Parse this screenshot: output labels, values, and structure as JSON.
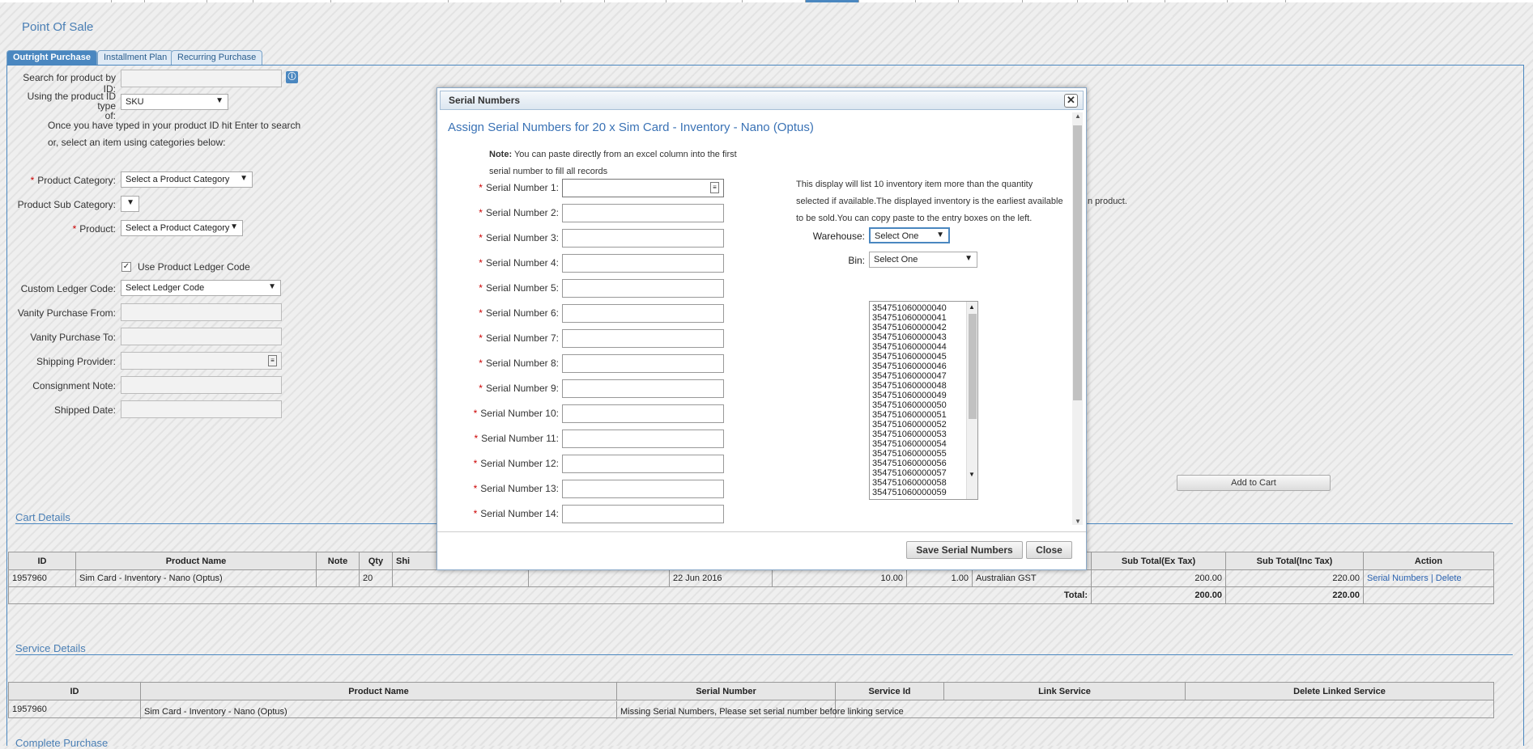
{
  "page": {
    "title": "Point Of Sale"
  },
  "tabs": [
    {
      "label": "Outright Purchase"
    },
    {
      "label": "Installment Plan"
    },
    {
      "label": "Recurring Purchase"
    }
  ],
  "form": {
    "search_label": "Search for product by ID:",
    "id_type_label_1": "Using the product ID type",
    "id_type_label_2": "of:",
    "id_type_value": "SKU",
    "hint_1": "Once you have typed in your product ID hit Enter to search",
    "hint_2": "or, select an item using categories below:",
    "category_label": "Product Category:",
    "category_value": "Select a Product Category",
    "subcategory_label": "Product Sub Category:",
    "product_label": "Product:",
    "product_value": "Select a Product Category",
    "use_ledger_label": "Use Product Ledger Code",
    "custom_ledger_label": "Custom Ledger Code:",
    "custom_ledger_value": "Select Ledger Code",
    "vanity_from_label": "Vanity Purchase From:",
    "vanity_to_label": "Vanity Purchase To:",
    "shipping_provider_label": "Shipping Provider:",
    "consignment_label": "Consignment Note:",
    "shipped_date_label": "Shipped Date:",
    "product_fragment": "n product.",
    "add_to_cart": "Add to Cart"
  },
  "cart": {
    "title": "Cart Details",
    "headers": [
      "ID",
      "Product Name",
      "Note",
      "Qty",
      "Shi",
      "Sub Total(Ex Tax)",
      "Sub Total(Inc Tax)",
      "Action"
    ],
    "row": {
      "id": "1957960",
      "name": "Sim Card - Inventory - Nano (Optus)",
      "note": "",
      "qty": "20",
      "date": "22 Jun 2016",
      "price": "10.00",
      "qty2": "1.00",
      "tax": "Australian GST",
      "sub_ex": "200.00",
      "sub_inc": "220.00",
      "action_serials": "Serial Numbers",
      "action_sep": "|",
      "action_delete": "Delete"
    },
    "total_label": "Total:",
    "total_ex": "200.00",
    "total_inc": "220.00"
  },
  "service": {
    "title": "Service Details",
    "headers": [
      "ID",
      "Product Name",
      "Serial Number",
      "Service Id",
      "Link Service",
      "Delete Linked Service"
    ],
    "row": {
      "id": "1957960",
      "name": "Sim Card - Inventory - Nano (Optus)",
      "message": "Missing Serial Numbers, Please set serial number before linking service"
    }
  },
  "complete": {
    "title": "Complete Purchase"
  },
  "dialog": {
    "title": "Serial Numbers",
    "heading": "Assign Serial Numbers for 20 x Sim Card - Inventory - Nano (Optus)",
    "note_bold": "Note:",
    "note_text_1": "You can paste directly from an excel column into the first",
    "note_text_2": "serial number to fill all records",
    "serial_labels": [
      "Serial Number 1:",
      "Serial Number 2:",
      "Serial Number 3:",
      "Serial Number 4:",
      "Serial Number 5:",
      "Serial Number 6:",
      "Serial Number 7:",
      "Serial Number 8:",
      "Serial Number 9:",
      "Serial Number 10:",
      "Serial Number 11:",
      "Serial Number 12:",
      "Serial Number 13:",
      "Serial Number 14:"
    ],
    "info_1": "This display will list 10 inventory item more than the quantity",
    "info_2": "selected if available.The displayed inventory is the earliest available",
    "info_3": "to be sold.You can copy paste to the entry boxes on the left.",
    "warehouse_label": "Warehouse:",
    "warehouse_value": "Select One",
    "bin_label": "Bin:",
    "bin_value": "Select One",
    "inventory": [
      "354751060000040",
      "354751060000041",
      "354751060000042",
      "354751060000043",
      "354751060000044",
      "354751060000045",
      "354751060000046",
      "354751060000047",
      "354751060000048",
      "354751060000049",
      "354751060000050",
      "354751060000051",
      "354751060000052",
      "354751060000053",
      "354751060000054",
      "354751060000055",
      "354751060000056",
      "354751060000057",
      "354751060000058",
      "354751060000059"
    ],
    "save_button": "Save Serial Numbers",
    "close_button": "Close"
  }
}
